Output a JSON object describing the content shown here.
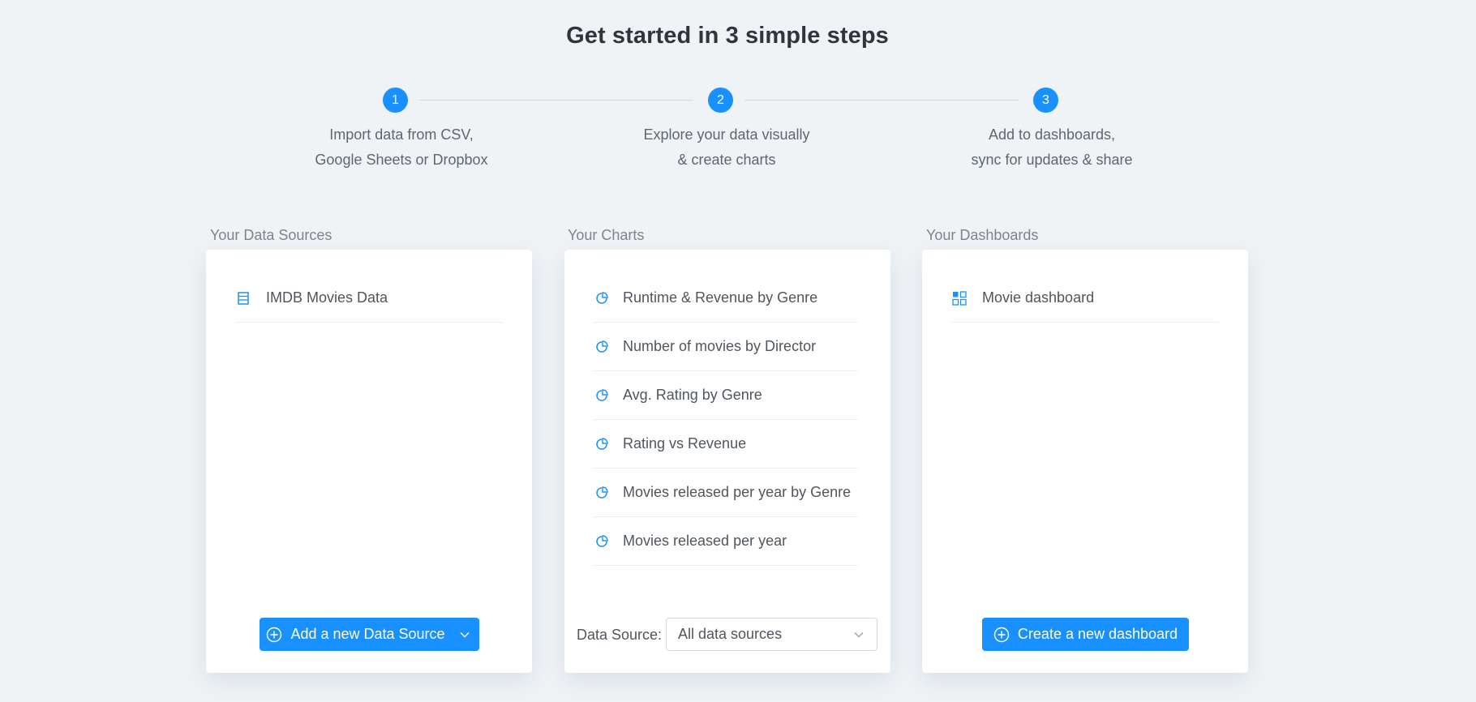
{
  "title": "Get started in 3 simple steps",
  "steps": [
    {
      "number": "1",
      "line1": "Import data from CSV,",
      "line2": "Google Sheets or Dropbox"
    },
    {
      "number": "2",
      "line1": "Explore your data visually",
      "line2": "& create charts"
    },
    {
      "number": "3",
      "line1": "Add to dashboards,",
      "line2": "sync for updates & share"
    }
  ],
  "data_sources": {
    "label": "Your Data Sources",
    "items": [
      {
        "label": "IMDB Movies Data",
        "icon": "table-icon"
      }
    ],
    "button_label": "Add a new Data Source"
  },
  "charts": {
    "label": "Your Charts",
    "items": [
      {
        "label": "Runtime & Revenue by Genre",
        "icon": "pie-chart-icon"
      },
      {
        "label": "Number of movies by Director",
        "icon": "pie-chart-icon"
      },
      {
        "label": "Avg. Rating by Genre",
        "icon": "pie-chart-icon"
      },
      {
        "label": "Rating vs Revenue",
        "icon": "pie-chart-icon"
      },
      {
        "label": "Movies released per year by Genre",
        "icon": "pie-chart-icon"
      },
      {
        "label": "Movies released per year",
        "icon": "pie-chart-icon"
      }
    ],
    "filter_label": "Data Source:",
    "filter_value": "All data sources"
  },
  "dashboards": {
    "label": "Your Dashboards",
    "items": [
      {
        "label": "Movie dashboard",
        "icon": "dashboard-icon"
      }
    ],
    "button_label": "Create a new dashboard"
  },
  "colors": {
    "accent": "#1890ff",
    "background": "#eff3f6",
    "panel": "#ffffff"
  }
}
